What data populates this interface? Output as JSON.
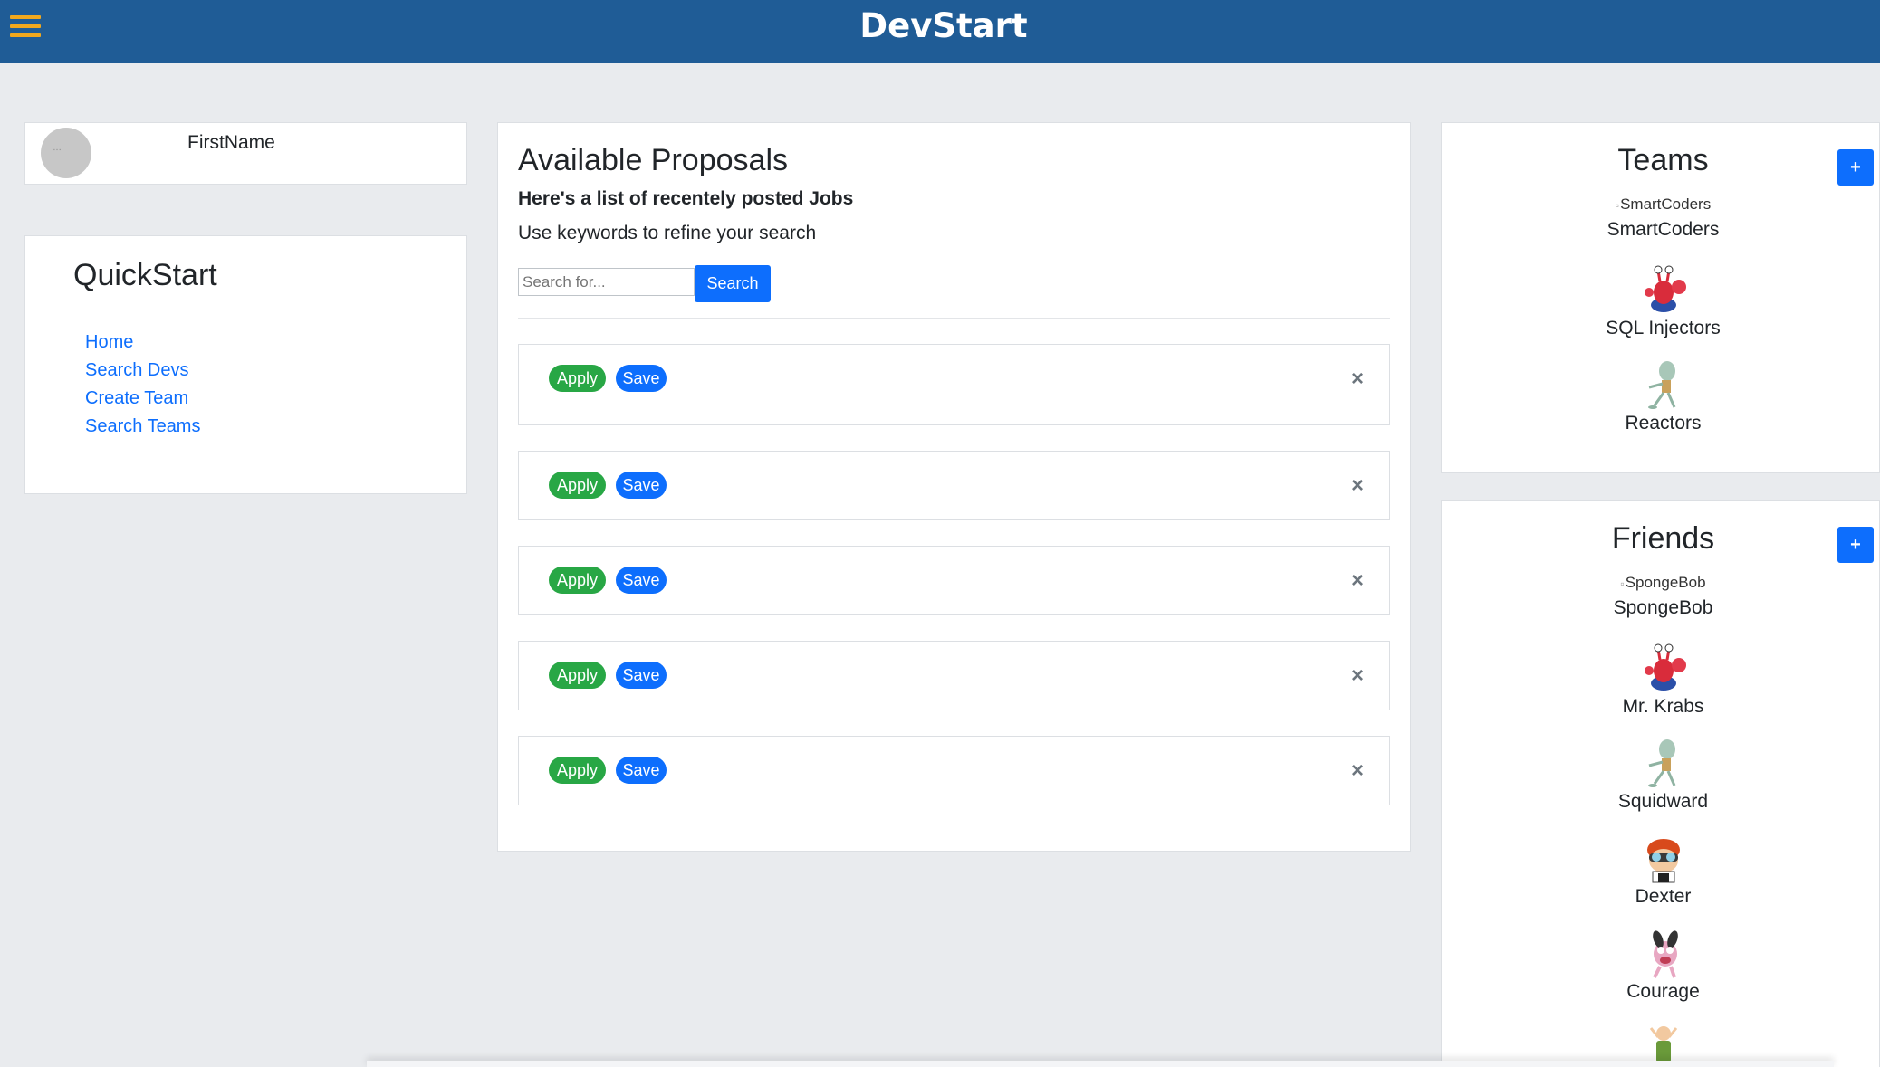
{
  "header": {
    "brand": "DevStart"
  },
  "profile": {
    "first_name": "FirstName"
  },
  "quickstart": {
    "title": "QuickStart",
    "links": [
      "Home",
      "Search Devs",
      "Create Team",
      "Search Teams"
    ]
  },
  "proposals": {
    "title": "Available Proposals",
    "subtitle": "Here's a list of recentely posted Jobs",
    "hint": "Use keywords to refine your search",
    "search_placeholder": "Search for...",
    "search_label": "Search",
    "jobs": [
      {
        "apply": "Apply",
        "save": "Save",
        "close": "×"
      },
      {
        "apply": "Apply",
        "save": "Save",
        "close": "×"
      },
      {
        "apply": "Apply",
        "save": "Save",
        "close": "×"
      },
      {
        "apply": "Apply",
        "save": "Save",
        "close": "×"
      },
      {
        "apply": "Apply",
        "save": "Save",
        "close": "×"
      }
    ]
  },
  "teams": {
    "title": "Teams",
    "add_label": "+",
    "items": [
      {
        "name": "SmartCoders",
        "alt": "SmartCoders",
        "icon": "broken-image-icon"
      },
      {
        "name": "SQL Injectors",
        "icon": "mr-krabs-avatar-icon"
      },
      {
        "name": "Reactors",
        "icon": "squidward-avatar-icon"
      }
    ]
  },
  "friends": {
    "title": "Friends",
    "add_label": "+",
    "items": [
      {
        "name": "SpongeBob",
        "alt": "SpongeBob",
        "icon": "broken-image-icon"
      },
      {
        "name": "Mr. Krabs",
        "icon": "mr-krabs-avatar-icon"
      },
      {
        "name": "Squidward",
        "icon": "squidward-avatar-icon"
      },
      {
        "name": "Dexter",
        "icon": "dexter-avatar-icon"
      },
      {
        "name": "Courage",
        "icon": "courage-avatar-icon"
      }
    ]
  },
  "colors": {
    "header_bg": "#1f5c96",
    "hamburger": "#f2a81d",
    "primary": "#0d6efd",
    "success": "#28a745",
    "page_bg": "#e9ebee"
  }
}
